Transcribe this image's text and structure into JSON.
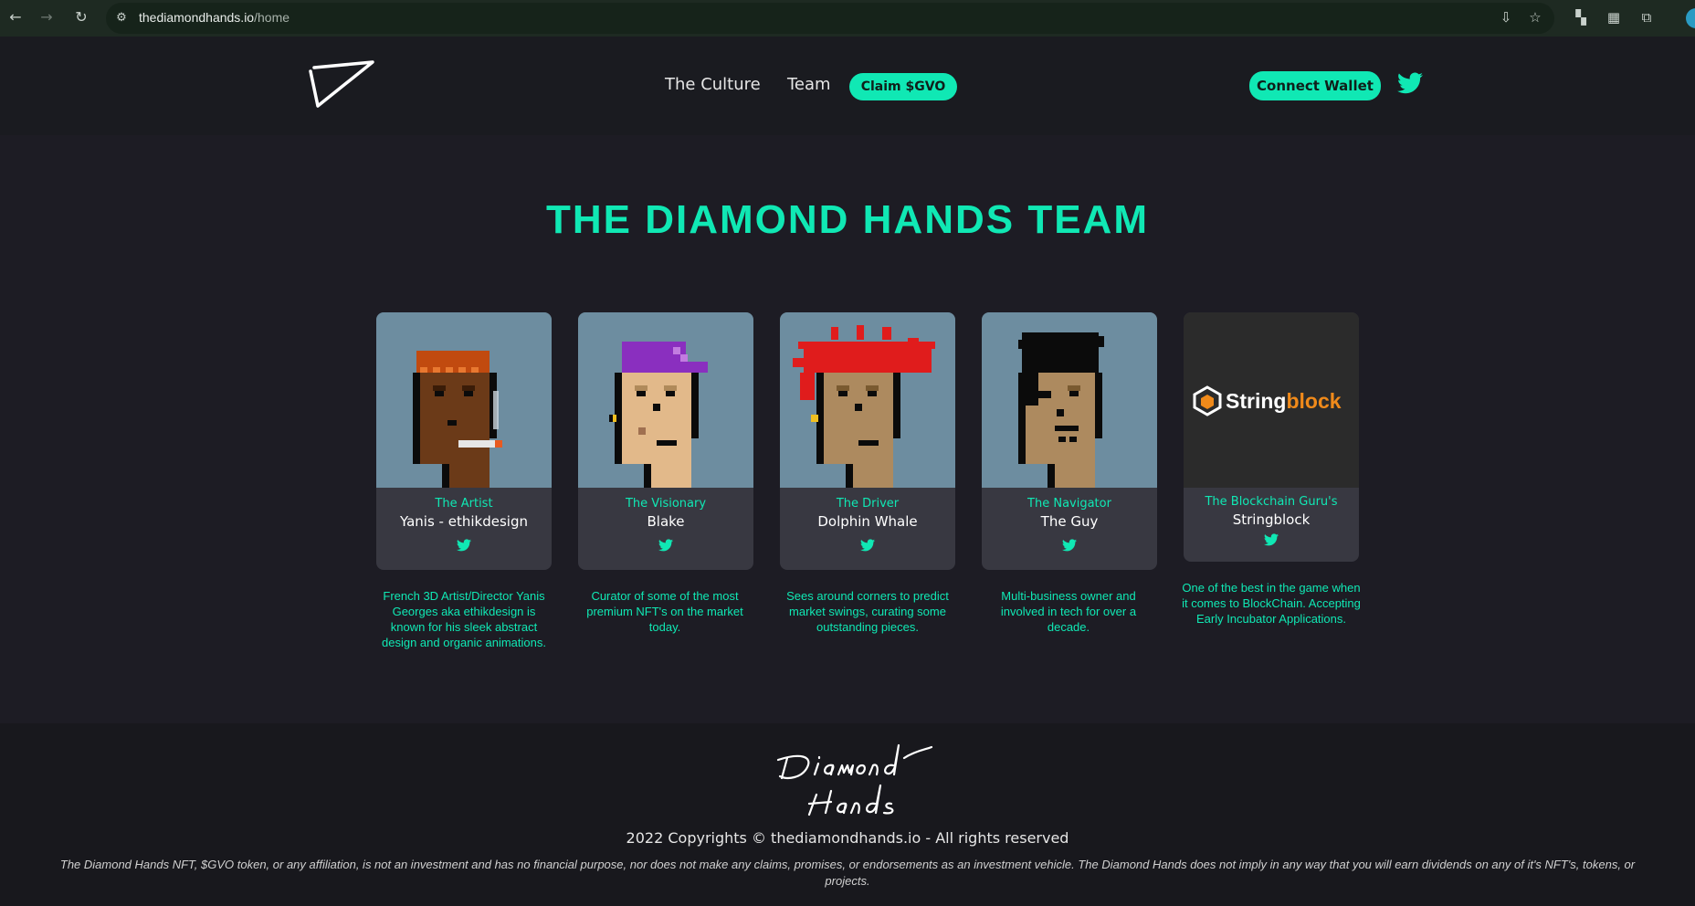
{
  "browser": {
    "url_host": "thediamondhands.io",
    "url_path": "/home"
  },
  "header": {
    "nav": {
      "culture": "The Culture",
      "team": "Team",
      "claim": "Claim $GVO"
    },
    "connect_wallet": "Connect Wallet"
  },
  "main": {
    "title": "THE DIAMOND HANDS TEAM",
    "members": [
      {
        "role": "The Artist",
        "name": "Yanis - ethikdesign",
        "description": "French 3D Artist/Director Yanis Georges aka ethikdesign is known for his sleek abstract design and organic animations."
      },
      {
        "role": "The Visionary",
        "name": "Blake",
        "description": "Curator of some of the most premium NFT's on the market today."
      },
      {
        "role": "The Driver",
        "name": "Dolphin Whale",
        "description": "Sees around corners to predict market swings, curating some outstanding pieces."
      },
      {
        "role": "The Navigator",
        "name": "The Guy",
        "description": "Multi-business owner and involved in tech for over a decade."
      },
      {
        "role": "The Blockchain Guru's",
        "name": "Stringblock",
        "description": "One of the best in the game when it comes to BlockChain. Accepting Early Incubator Applications."
      }
    ],
    "stringblock_logo": {
      "part1": "String",
      "part2": "block"
    }
  },
  "footer": {
    "copyright": "2022 Copyrights © thediamondhands.io - All rights reserved",
    "disclaimer": "The Diamond Hands NFT, $GVO token, or any affiliation, is not an investment and has no financial purpose, nor does not make any claims, promises, or endorsements as an investment vehicle. The Diamond Hands does not imply in any way that you will earn dividends on any of it's NFT's, tokens, or projects."
  },
  "colors": {
    "accent": "#10e8b4",
    "background": "#1d1c24",
    "header_bg": "#1a1b20",
    "footer_bg": "#18181d",
    "card_bg": "#383841",
    "avatar_bg": "#6d8da0",
    "twitter": "#1da1f2"
  }
}
